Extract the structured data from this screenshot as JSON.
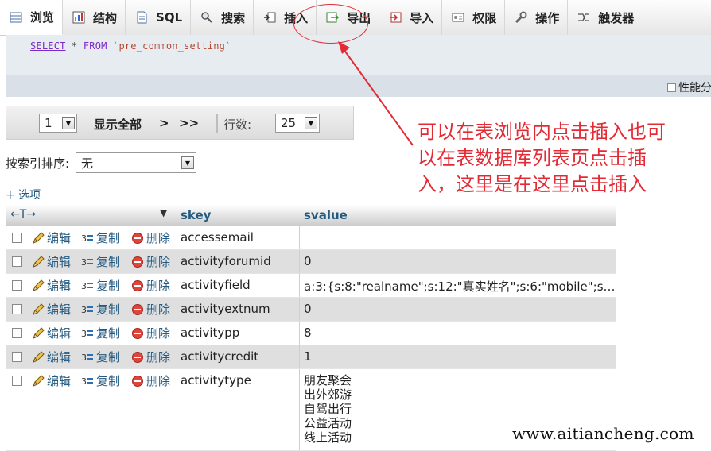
{
  "tabs": [
    {
      "label": "浏览",
      "icon": "browse-icon",
      "active": true
    },
    {
      "label": "结构",
      "icon": "structure-icon"
    },
    {
      "label": "SQL",
      "icon": "sql-icon"
    },
    {
      "label": "搜索",
      "icon": "search-icon"
    },
    {
      "label": "插入",
      "icon": "insert-icon"
    },
    {
      "label": "导出",
      "icon": "export-icon"
    },
    {
      "label": "导入",
      "icon": "import-icon"
    },
    {
      "label": "权限",
      "icon": "privileges-icon"
    },
    {
      "label": "操作",
      "icon": "operations-icon"
    },
    {
      "label": "触发器",
      "icon": "triggers-icon"
    }
  ],
  "sql": {
    "select": "SELECT",
    "star": "*",
    "from": "FROM",
    "table": "`pre_common_setting`",
    "profiling_label": "性能分"
  },
  "nav": {
    "page_value": "1",
    "show_all": "显示全部",
    "next": ">",
    "last": ">>",
    "rows_label": "行数:",
    "rows_value": "25"
  },
  "sort": {
    "label": "按索引排序:",
    "value": "无"
  },
  "options_link": "+ 选项",
  "table": {
    "arrows": "←T→",
    "col_key": "skey",
    "col_value": "svalue",
    "actions": {
      "edit": "编辑",
      "copy": "复制",
      "delete": "删除"
    },
    "rows": [
      {
        "key": "accessemail",
        "value": ""
      },
      {
        "key": "activityforumid",
        "value": "0"
      },
      {
        "key": "activityfield",
        "value": "a:3:{s:8:\"realname\";s:12:\"真实姓名\";s:6:\"mobile\";s:6:\"..."
      },
      {
        "key": "activityextnum",
        "value": "0"
      },
      {
        "key": "activitypp",
        "value": "8"
      },
      {
        "key": "activitycredit",
        "value": "1"
      },
      {
        "key": "activitytype",
        "value_lines": [
          "朋友聚会",
          "出外郊游",
          "自驾出行",
          "公益活动",
          "线上活动"
        ]
      }
    ]
  },
  "annotation": {
    "lines": [
      "可以在表浏览内点击插入也可",
      "以在表数据库列表页点击插",
      "入，这里是在这里点击插入"
    ],
    "color": "#e32b35"
  },
  "watermark": "www.aitiancheng.com"
}
